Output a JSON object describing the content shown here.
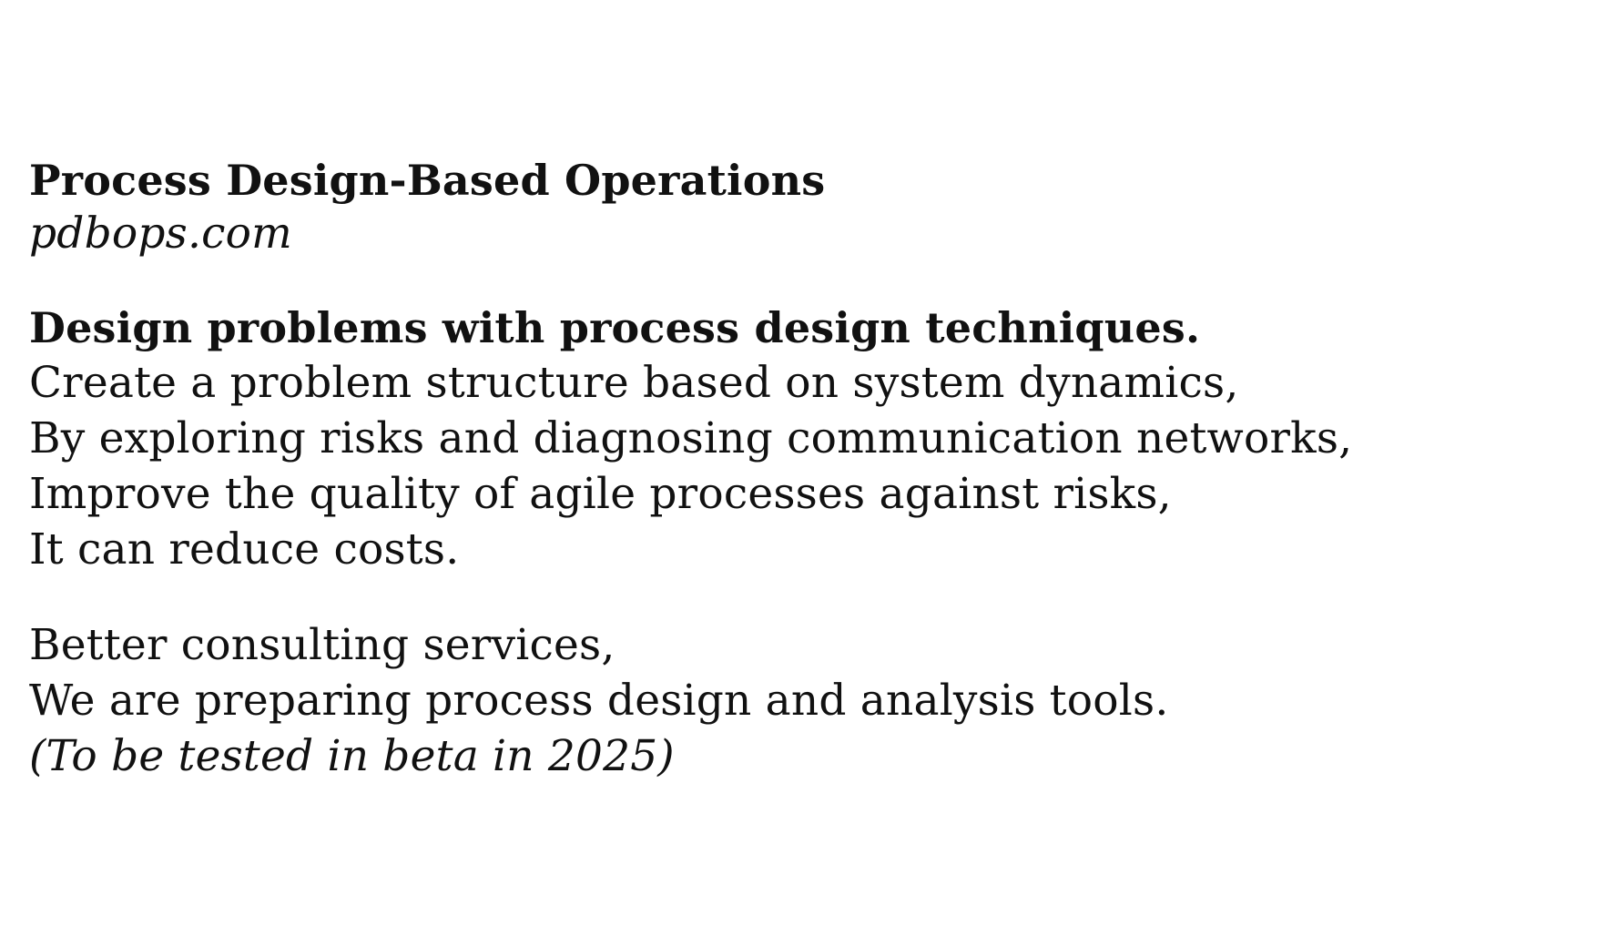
{
  "header": {
    "title": "Process Design-Based Operations",
    "domain": "pdbops.com"
  },
  "intro": {
    "headline": "Design problems with process design techniques.",
    "lines": [
      "Create a problem structure based on system dynamics,",
      "By exploring risks and diagnosing communication networks,",
      "Improve the quality of agile processes against risks,",
      "It can reduce costs."
    ]
  },
  "outro": {
    "lines": [
      "Better consulting services,",
      "We are preparing process design and analysis tools."
    ],
    "note": "(To be tested in beta in 2025)"
  }
}
